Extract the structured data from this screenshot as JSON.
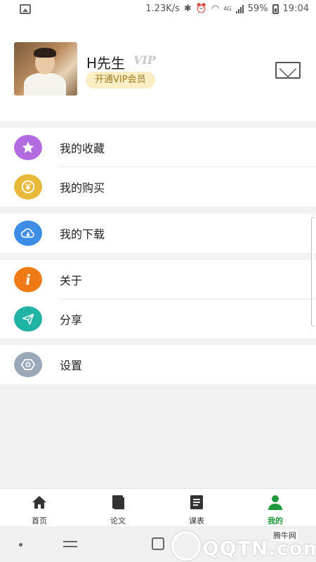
{
  "status_bar": {
    "speed": "1.23K/s",
    "network": "4G",
    "battery": "59%",
    "time": "19:04"
  },
  "profile": {
    "username": "H先生",
    "vip_mark": "VIP",
    "vip_badge": "开通VIP会员"
  },
  "menu": {
    "groups": [
      {
        "items": [
          {
            "label": "我的收藏",
            "icon": "star-icon",
            "color": "#b36be0"
          },
          {
            "label": "我的购买",
            "icon": "yen-coin-icon",
            "color": "#e8b93a"
          }
        ]
      },
      {
        "items": [
          {
            "label": "我的下载",
            "icon": "cloud-download-icon",
            "color": "#3d8de6"
          }
        ]
      },
      {
        "items": [
          {
            "label": "关于",
            "icon": "info-icon",
            "color": "#f07a16"
          },
          {
            "label": "分享",
            "icon": "paper-plane-icon",
            "color": "#21b3a3"
          }
        ]
      },
      {
        "items": [
          {
            "label": "设置",
            "icon": "gear-icon",
            "color": "#9aa8b8"
          }
        ]
      }
    ]
  },
  "tabbar": {
    "tabs": [
      {
        "label": "首页",
        "icon": "home-icon"
      },
      {
        "label": "论文",
        "icon": "book-icon"
      },
      {
        "label": "课表",
        "icon": "list-icon"
      },
      {
        "label": "我的",
        "icon": "user-icon",
        "active": true
      }
    ],
    "active_color": "#1e9a3d"
  },
  "watermark": {
    "text": "QQTN.com",
    "subtitle": "腾牛网"
  }
}
